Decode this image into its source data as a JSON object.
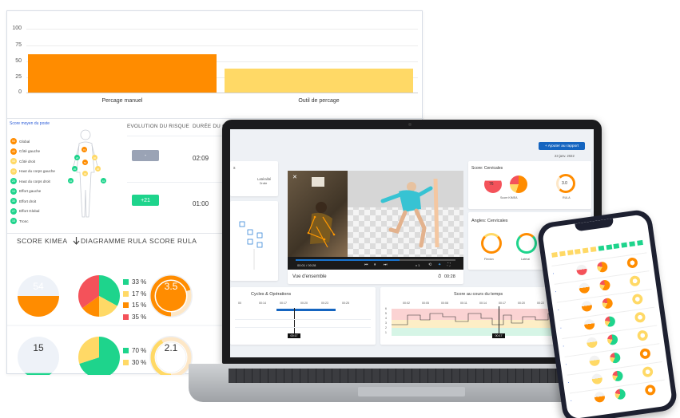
{
  "bar_chart": {
    "type": "bar",
    "categories": [
      "Percage manuel",
      "Outil de percage"
    ],
    "series": [
      {
        "values": [
          60,
          38
        ],
        "colors": [
          "#ff8c00",
          "#ffd966"
        ]
      }
    ],
    "y_ticks": [
      "100",
      "75",
      "50",
      "25",
      "0"
    ],
    "ylim": [
      0,
      100
    ]
  },
  "chart_data": {
    "type": "bar",
    "categories": [
      "Percage manuel",
      "Outil de percage"
    ],
    "values": [
      60,
      38
    ],
    "ylim": [
      0,
      100
    ],
    "grid": true
  },
  "body_map": {
    "title": "Score moyen du poste",
    "legend": [
      {
        "badge": "54",
        "label": "Global",
        "color": "#ff8c00"
      },
      {
        "badge": "44",
        "label": "Côté gauche",
        "color": "#ff8c00"
      },
      {
        "badge": "44",
        "label": "Côté droit",
        "color": "#ffd966"
      },
      {
        "badge": "10",
        "label": "Haut du corps gauche",
        "color": "#ffd966"
      },
      {
        "badge": "20",
        "label": "Haut du corps droit",
        "color": "#1ed48c"
      },
      {
        "badge": "10",
        "label": "Effort gauche",
        "color": "#1ed48c"
      },
      {
        "badge": "30",
        "label": "Effort droit",
        "color": "#1ed48c"
      },
      {
        "badge": "27",
        "label": "Effort Global",
        "color": "#1ed48c"
      },
      {
        "badge": "15",
        "label": "Tronc",
        "color": "#1ed48c"
      }
    ]
  },
  "risk_table": {
    "headers": [
      "EVOLUTION DU RISQUE",
      "DURÉE DU CYCLE"
    ],
    "rows": [
      {
        "evolution": "-",
        "evolution_color": "#9aa3b5",
        "duration": "02:09"
      },
      {
        "evolution": "+21",
        "evolution_color": "#1ed48c",
        "duration": "01:00"
      }
    ]
  },
  "score_table": {
    "headers": [
      "SCORE KIMEA",
      "DIAGRAMME RULA",
      "SCORE RULA"
    ],
    "sort_icon": "arrow-down-icon",
    "rows": [
      {
        "kimea": "54",
        "kimea_color": "#ff8c00",
        "kimea_fill": 0.54,
        "rula_slices": [
          {
            "pct": "33 %",
            "value": 33,
            "color": "#1ed48c"
          },
          {
            "pct": "17 %",
            "value": 17,
            "color": "#ffd966"
          },
          {
            "pct": "15 %",
            "value": 15,
            "color": "#ff8c00"
          },
          {
            "pct": "35 %",
            "value": 35,
            "color": "#f4525a"
          }
        ],
        "rula": "3.5",
        "rula_color": "#ff8c00",
        "rula_fill": 0.7
      },
      {
        "kimea": "15",
        "kimea_color": "#1ed48c",
        "kimea_fill": 0.15,
        "rula_slices": [
          {
            "pct": "70 %",
            "value": 70,
            "color": "#1ed48c"
          },
          {
            "pct": "30 %",
            "value": 30,
            "color": "#ffd966"
          }
        ],
        "rula": "2.1",
        "rula_color": "#ffd966",
        "rula_fill": 0.42
      }
    ]
  },
  "laptop": {
    "add_button": "+ Ajouter au rapport",
    "date": "23 janv. 2022",
    "lateralite_label": "Latéralité",
    "lateralite_value": "Droite",
    "video": {
      "close": "✕",
      "time": "00:01 / 00:28",
      "speed": "x 1",
      "caption": "Vue d'ensemble",
      "duration": "00:28"
    },
    "score_card": {
      "title": "Score: Cervicales",
      "kimea_value": "76",
      "kimea_label": "Score KIMEA",
      "rula_value": "3.0",
      "rula_label": "RULA"
    },
    "angles_card": {
      "title": "Angles: Cervicales",
      "gauges": [
        "Flexion",
        "Latéral"
      ]
    },
    "cycles_card": {
      "title": "Cycles & Opérations",
      "ticks": [
        "00",
        "00:14",
        "00:17",
        "00:20",
        "00:23",
        "00:25"
      ],
      "marker": "00:17"
    },
    "timeline_card": {
      "title": "Score au cours du temps",
      "ticks": [
        "00:02",
        "00:05",
        "00:08",
        "00:11",
        "00:14",
        "00:17",
        "00:20",
        "00:22",
        "00:25"
      ],
      "y_ticks": [
        "6",
        "5",
        "4",
        "3",
        "2",
        "1"
      ],
      "marker": "00:17"
    }
  }
}
